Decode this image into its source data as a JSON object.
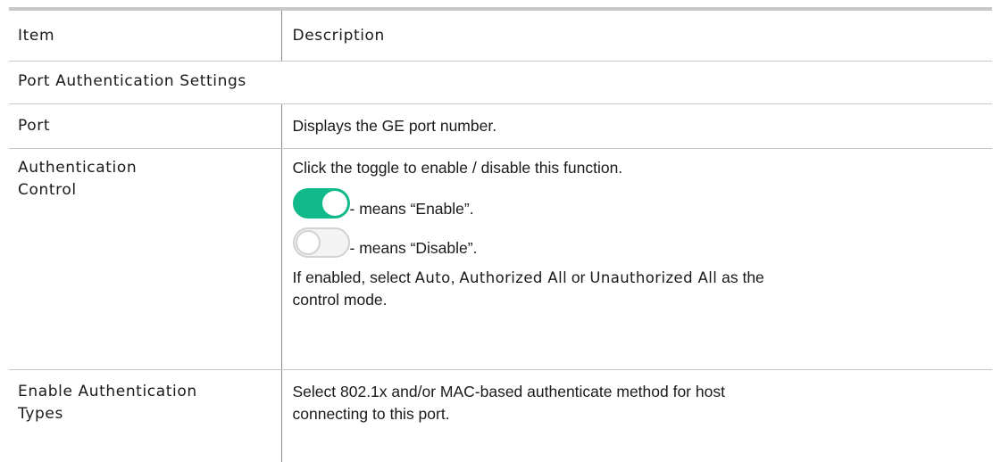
{
  "table": {
    "header": {
      "item": "Item",
      "description": "Description"
    },
    "section_title": "Port Authentication Settings",
    "rows": [
      {
        "item": "Port",
        "description": "Displays the GE port number."
      },
      {
        "item_line1": "Authentication",
        "item_line2": "Control",
        "description_intro": "Click the toggle to enable / disable this function.",
        "toggle_on_text": "- means “Enable”.",
        "toggle_off_text": "- means “Disable”.",
        "description_tail_1": "If enabled, select ",
        "option_auto": "Auto",
        "description_tail_2": ", ",
        "option_authorized_all": "Authorized All",
        "description_tail_3": " or ",
        "option_unauthorized_all": "Unauthorized All",
        "description_tail_4": " as the",
        "description_tail_5": "control mode."
      },
      {
        "item_line1": "Enable Authentication",
        "item_line2": "Types",
        "description_line1": "Select 802.1x and/or MAC-based authenticate method for host",
        "description_line2": "connecting to this port."
      }
    ]
  },
  "colors": {
    "toggle_on": "#12b98a",
    "toggle_off_border": "#d2d2d2",
    "rule": "#c8c8c8"
  },
  "icons": {
    "toggle_on": "toggle-on-icon",
    "toggle_off": "toggle-off-icon"
  }
}
